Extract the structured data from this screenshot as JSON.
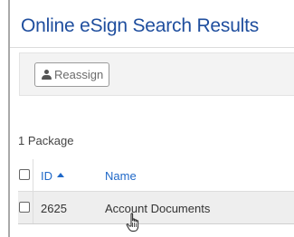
{
  "page": {
    "title": "Online eSign Search Results"
  },
  "toolbar": {
    "reassign_label": "Reassign",
    "reassign_icon": "person-icon"
  },
  "results": {
    "package_count": "1 Package"
  },
  "table": {
    "columns": [
      {
        "label": "ID",
        "sort": "ascending"
      },
      {
        "label": "Name"
      }
    ],
    "rows": [
      {
        "id": "2625",
        "name": "Account Documents"
      }
    ]
  },
  "colors": {
    "title": "#1f4e9e",
    "link": "#1f68c8",
    "toolbar_bg": "#f3f3f3",
    "row_bg": "#eeeeee"
  }
}
